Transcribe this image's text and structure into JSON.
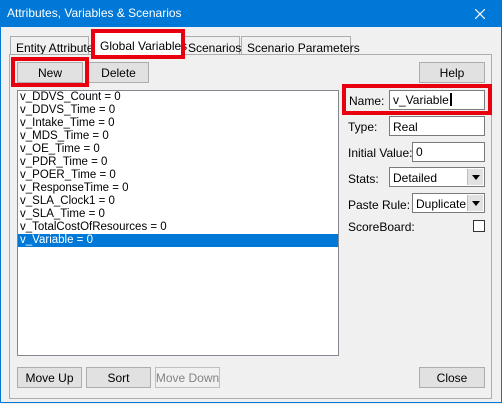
{
  "window": {
    "title": "Attributes, Variables & Scenarios"
  },
  "tabs": [
    {
      "label": "Entity Attributes",
      "active": false
    },
    {
      "label": "Global Variables",
      "active": true
    },
    {
      "label": "Scenarios",
      "active": false
    },
    {
      "label": "Scenario Parameters",
      "active": false
    }
  ],
  "toolbar": {
    "new_label": "New",
    "delete_label": "Delete",
    "help_label": "Help"
  },
  "variables": [
    "v_DDVS_Count = 0",
    "v_DDVS_Time = 0",
    "v_Intake_Time = 0",
    "v_MDS_Time = 0",
    "v_OE_Time = 0",
    "v_PDR_Time = 0",
    "v_POER_Time = 0",
    "v_ResponseTime = 0",
    "v_SLA_Clock1 = 0",
    "v_SLA_Time = 0",
    "v_TotalCostOfResources = 0",
    "v_Variable = 0"
  ],
  "selected_index": 11,
  "form": {
    "name_label": "Name:",
    "name_value": "v_Variable",
    "type_label": "Type:",
    "type_value": "Real",
    "initial_value_label": "Initial Value:",
    "initial_value": "0",
    "stats_label": "Stats:",
    "stats_value": "Detailed",
    "paste_rule_label": "Paste Rule:",
    "paste_rule_value": "Duplicate",
    "scoreboard_label": "ScoreBoard:",
    "scoreboard_checked": false
  },
  "bottom": {
    "move_up_label": "Move Up",
    "sort_label": "Sort",
    "move_down_label": "Move Down",
    "close_label": "Close"
  },
  "colors": {
    "titlebar": "#0078d7",
    "selection": "#0078d7",
    "highlight": "#e8000f"
  }
}
